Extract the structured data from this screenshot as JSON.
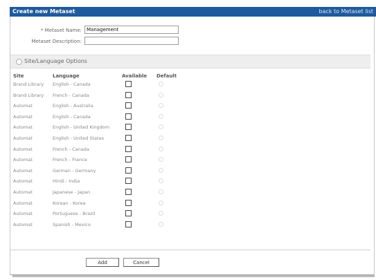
{
  "header": {
    "title": "Create new Metaset",
    "back_link": "back to Metaset list"
  },
  "form": {
    "name_label": "* Metaset Name:",
    "name_value": "Management",
    "description_label": "Metaset Description:",
    "description_value": ""
  },
  "section": {
    "title": "Site/Language Options"
  },
  "table": {
    "headers": {
      "site": "Site",
      "language": "Language",
      "available": "Available",
      "default": "Default"
    },
    "rows": [
      {
        "site": "Brand Library",
        "language": "English - Canada"
      },
      {
        "site": "Brand Library",
        "language": "French - Canada"
      },
      {
        "site": "Automat",
        "language": "English - Australia"
      },
      {
        "site": "Automat",
        "language": "English - Canada"
      },
      {
        "site": "Automat",
        "language": "English - United Kingdom"
      },
      {
        "site": "Automat",
        "language": "English - United States"
      },
      {
        "site": "Automat",
        "language": "French - Canada"
      },
      {
        "site": "Automat",
        "language": "French - France"
      },
      {
        "site": "Automat",
        "language": "German - Germany"
      },
      {
        "site": "Automat",
        "language": "Hindi - India"
      },
      {
        "site": "Automat",
        "language": "Japanese - Japan"
      },
      {
        "site": "Automat",
        "language": "Korean - Korea"
      },
      {
        "site": "Automat",
        "language": "Portuguese - Brazil"
      },
      {
        "site": "Automat",
        "language": "Spanish - Mexico"
      }
    ]
  },
  "buttons": {
    "add": "Add",
    "cancel": "Cancel"
  },
  "colors": {
    "header_bg": "#1f5a9c",
    "section_bg": "#eeeeee"
  }
}
